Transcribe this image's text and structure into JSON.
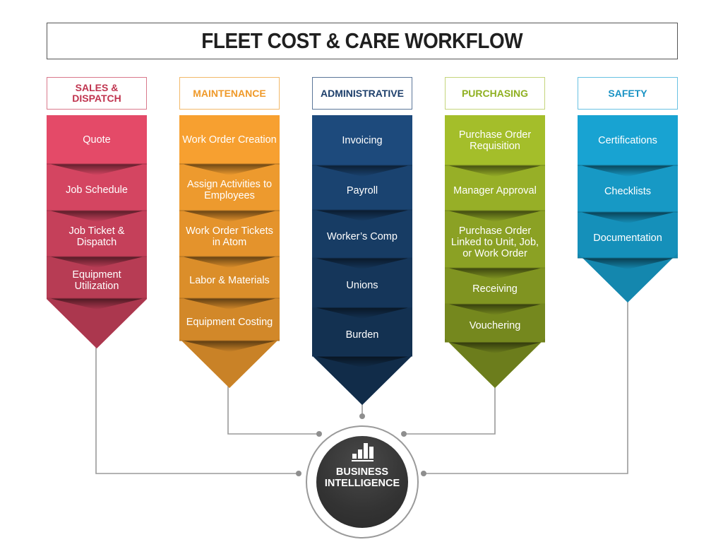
{
  "title": "FLEET COST & CARE WORKFLOW",
  "columns": [
    {
      "id": "sales-dispatch",
      "label": "SALES & DISPATCH",
      "label_lines": [
        "SALES &",
        "DISPATCH"
      ],
      "color": "#e44a68",
      "header_color": "#c0344f",
      "steps": [
        "Quote",
        "Job Schedule",
        "Job Ticket & Dispatch",
        "Equipment Utilization"
      ]
    },
    {
      "id": "maintenance",
      "label": "MAINTENANCE",
      "label_lines": [
        "MAINTENANCE"
      ],
      "color": "#f7a030",
      "header_color": "#ef9a2a",
      "steps": [
        "Work Order Creation",
        "Assign Activities to Employees",
        "Work Order Tickets in Atom",
        "Labor & Materials",
        "Equipment Costing"
      ]
    },
    {
      "id": "administrative",
      "label": "ADMINISTRATIVE",
      "label_lines": [
        "ADMINISTRATIVE"
      ],
      "color": "#1d4a7c",
      "header_color": "#1d3f6b",
      "steps": [
        "Invoicing",
        "Payroll",
        "Worker’s Comp",
        "Unions",
        "Burden"
      ]
    },
    {
      "id": "purchasing",
      "label": "PURCHASING",
      "label_lines": [
        "PURCHASING"
      ],
      "color": "#a4be2a",
      "header_color": "#8fb021",
      "steps": [
        "Purchase Order Requisition",
        "Manager Approval",
        "Purchase Order Linked to Unit, Job, or Work Order",
        "Receiving",
        "Vouchering"
      ]
    },
    {
      "id": "safety",
      "label": "SAFETY",
      "label_lines": [
        "SAFETY"
      ],
      "color": "#18a3d2",
      "header_color": "#1a93c4",
      "steps": [
        "Certifications",
        "Checklists",
        "Documentation"
      ]
    }
  ],
  "hub": {
    "label": "BUSINESS INTELLIGENCE",
    "label_lines": [
      "BUSINESS",
      "INTELLIGENCE"
    ],
    "icon": "bar-chart-icon"
  },
  "colors": {
    "connector": "#9a9a9a",
    "hub_dark": "#333333"
  }
}
